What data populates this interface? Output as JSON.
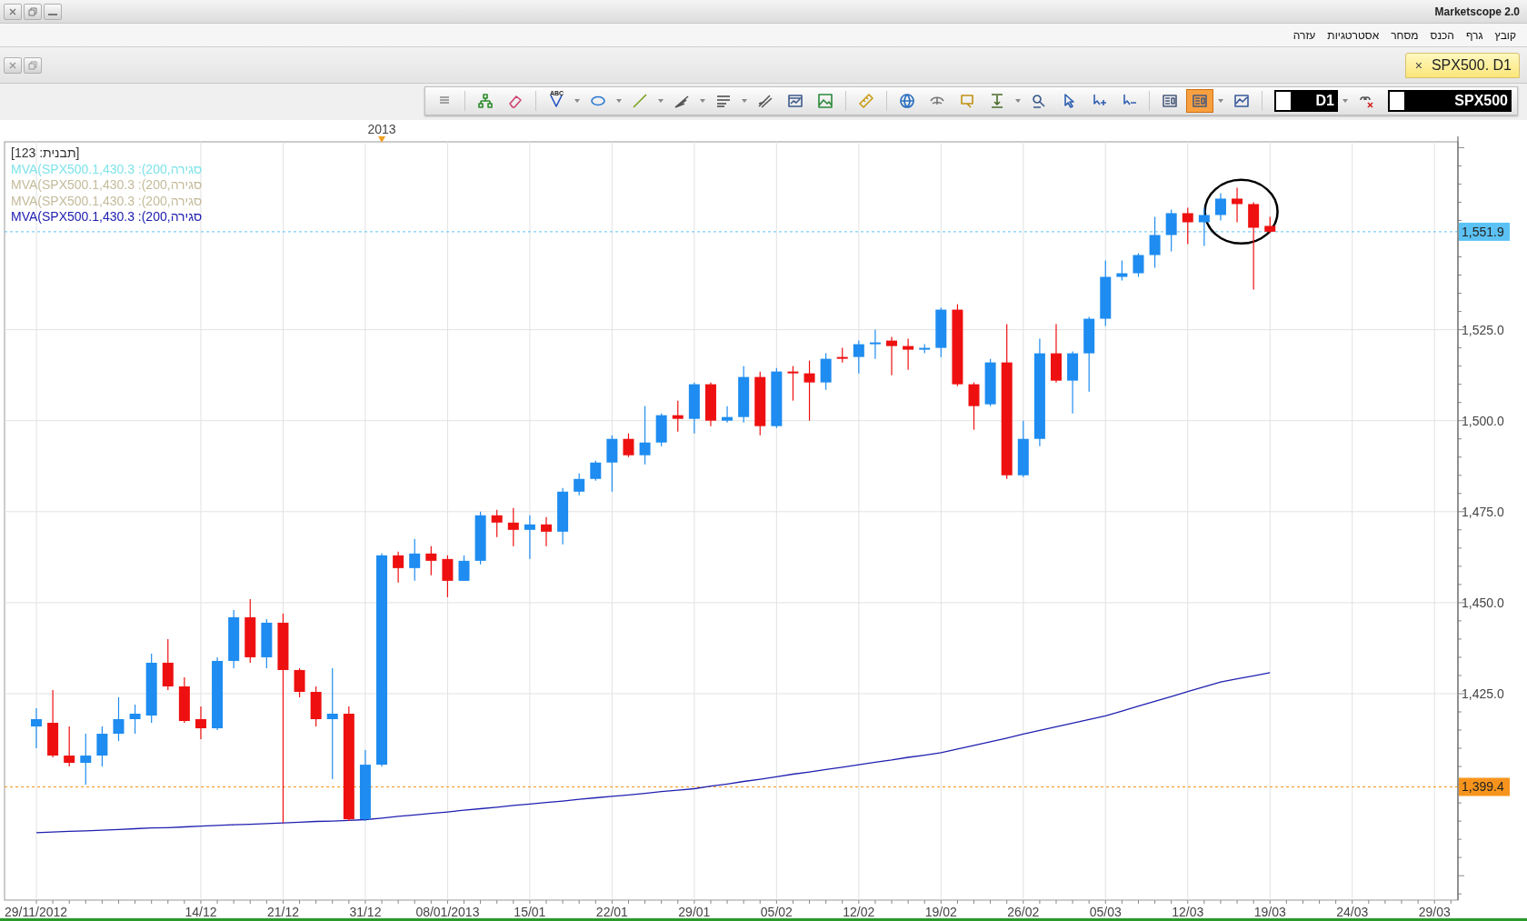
{
  "window": {
    "title": "Marketscope 2.0"
  },
  "menu": [
    "קובץ",
    "גרף",
    "הכנס",
    "מסחר",
    "אסטרטגיות",
    "עזרה"
  ],
  "document_tab": {
    "close": "×",
    "label": "SPX500. D1",
    "selected": true
  },
  "toolbar": {
    "tools": [
      {
        "kind": "grip",
        "selected": false,
        "caret": false
      },
      {
        "kind": "hierarchy",
        "selected": false,
        "caret": false
      },
      {
        "kind": "eraser",
        "selected": false,
        "caret": false
      },
      {
        "kind": "text",
        "label": "ABC",
        "selected": false,
        "caret": true
      },
      {
        "kind": "ellipse",
        "selected": false,
        "caret": true
      },
      {
        "kind": "pencil",
        "selected": false,
        "caret": true
      },
      {
        "kind": "fan",
        "selected": false,
        "caret": true
      },
      {
        "kind": "lines",
        "selected": false,
        "caret": true
      },
      {
        "kind": "fork",
        "selected": false,
        "caret": false
      },
      {
        "kind": "window",
        "selected": false,
        "caret": false
      },
      {
        "kind": "image",
        "selected": false,
        "caret": false
      },
      {
        "kind": "ruler",
        "selected": false,
        "caret": false
      },
      {
        "kind": "globe",
        "selected": false,
        "caret": false
      },
      {
        "kind": "eye",
        "selected": false,
        "caret": false
      },
      {
        "kind": "marker",
        "selected": false,
        "caret": false
      },
      {
        "kind": "level",
        "selected": false,
        "caret": true
      },
      {
        "kind": "zoom",
        "selected": false,
        "caret": false
      },
      {
        "kind": "cursor",
        "selected": false,
        "caret": false
      },
      {
        "kind": "cursor-plus",
        "selected": false,
        "caret": false
      },
      {
        "kind": "cursor-minus",
        "selected": false,
        "caret": false
      },
      {
        "kind": "panel",
        "selected": false,
        "caret": false
      },
      {
        "kind": "panel",
        "selected": true,
        "caret": true
      },
      {
        "kind": "chart",
        "selected": false,
        "caret": false
      }
    ],
    "timeframe": "D1",
    "instrument": "SPX500"
  },
  "chart": {
    "legend": [
      {
        "text": "[תבנית: 123]",
        "color": "#333333"
      },
      {
        "text": "MVA(SPX500.1,430.3 :(200,סגירה",
        "color": "#7fe3ea"
      },
      {
        "text": "MVA(SPX500.1,430.3 :(200,סגירה",
        "color": "#c4bb9a"
      },
      {
        "text": "MVA(SPX500.1,430.3 :(200,סגירה",
        "color": "#c4bb9a"
      }
    ],
    "year_label": "2013",
    "chart_data": {
      "type": "candlestick",
      "grid": true,
      "ylim": [
        1368.3,
        1576.6
      ],
      "categories": [
        "29/11/2012",
        null,
        null,
        null,
        null,
        null,
        null,
        null,
        null,
        null,
        "14/12",
        null,
        null,
        null,
        null,
        "21/12",
        null,
        null,
        null,
        null,
        "31/12",
        null,
        null,
        null,
        null,
        "08/01/2013",
        null,
        null,
        null,
        null,
        "15/01",
        null,
        null,
        null,
        null,
        "22/01",
        null,
        null,
        null,
        null,
        "29/01",
        null,
        null,
        null,
        null,
        "05/02",
        null,
        null,
        null,
        null,
        "12/02",
        null,
        null,
        null,
        null,
        "19/02",
        null,
        null,
        null,
        null,
        "26/02",
        null,
        null,
        null,
        null,
        "05/03",
        null,
        null,
        null,
        null,
        "12/03",
        null,
        null,
        null,
        null,
        "19/03",
        null,
        null,
        null,
        null,
        "24/03",
        null,
        null,
        null,
        null,
        "29/03",
        null
      ],
      "yticks": [
        {
          "value": 1425,
          "label": "1,425.0"
        },
        {
          "value": 1450,
          "label": "1,450.0"
        },
        {
          "value": 1475,
          "label": "1,475.0"
        },
        {
          "value": 1500,
          "label": "1,500.0"
        },
        {
          "value": 1525,
          "label": "1,525.0"
        }
      ],
      "series": [
        {
          "ohlc": [
            [
              1416,
              1421,
              1410,
              1418
            ],
            [
              1417,
              1426,
              1407.5,
              1408
            ],
            [
              1408,
              1416,
              1405,
              1406
            ],
            [
              1406,
              1414,
              1400,
              1408
            ],
            [
              1408,
              1416,
              1405,
              1414
            ],
            [
              1414,
              1424,
              1412,
              1418
            ],
            [
              1418,
              1422,
              1414,
              1419.5
            ],
            [
              1419,
              1436,
              1417,
              1433.5
            ],
            [
              1433.5,
              1440,
              1426,
              1427
            ],
            [
              1427,
              1429.5,
              1417,
              1417.5
            ],
            [
              1418,
              1421.5,
              1412.5,
              1415.5
            ],
            [
              1415.5,
              1435,
              1415,
              1434
            ],
            [
              1434,
              1448,
              1432,
              1446
            ],
            [
              1446,
              1451,
              1433.5,
              1435
            ],
            [
              1435,
              1445.5,
              1432,
              1444.5
            ],
            [
              1444.5,
              1447,
              1389.5,
              1431.5
            ],
            [
              1431.5,
              1432,
              1424,
              1425.5
            ],
            [
              1425.5,
              1427,
              1416,
              1418
            ],
            [
              1418,
              1432,
              1401.5,
              1419.5
            ],
            [
              1419.5,
              1421.5,
              1390,
              1390.5
            ],
            [
              1390.5,
              1409.5,
              1390,
              1405.5
            ],
            [
              1405.5,
              1463.5,
              1405,
              1463
            ],
            [
              1463,
              1464,
              1455.5,
              1459.5
            ],
            [
              1459.5,
              1467.5,
              1456,
              1463.5
            ],
            [
              1463.5,
              1465.5,
              1457.5,
              1461.5
            ],
            [
              1462,
              1463,
              1451.5,
              1456
            ],
            [
              1456,
              1463,
              1456,
              1461.5
            ],
            [
              1461.5,
              1475,
              1460.5,
              1474
            ],
            [
              1474,
              1475.5,
              1468,
              1472
            ],
            [
              1472,
              1476,
              1465.5,
              1470
            ],
            [
              1470,
              1474,
              1462,
              1471.5
            ],
            [
              1471.5,
              1473.5,
              1465.5,
              1469.5
            ],
            [
              1469.5,
              1481.5,
              1466,
              1480.5
            ],
            [
              1480.5,
              1485.5,
              1479.5,
              1484
            ],
            [
              1484,
              1489,
              1483.5,
              1488.5
            ],
            [
              1488.5,
              1496,
              1480.5,
              1495
            ],
            [
              1495,
              1496.5,
              1490,
              1490.5
            ],
            [
              1490.5,
              1504,
              1488,
              1494
            ],
            [
              1494,
              1502,
              1493,
              1501.5
            ],
            [
              1501.5,
              1505.5,
              1497,
              1500.5
            ],
            [
              1500.5,
              1510.5,
              1496.5,
              1510
            ],
            [
              1510,
              1510.5,
              1498.5,
              1500
            ],
            [
              1500,
              1504,
              1499.5,
              1501
            ],
            [
              1501,
              1515,
              1499.5,
              1512
            ],
            [
              1512,
              1513.5,
              1496,
              1498.5
            ],
            [
              1498.5,
              1514.5,
              1498,
              1513.5
            ],
            [
              1513.5,
              1515,
              1505.5,
              1513
            ],
            [
              1513,
              1516.5,
              1500,
              1510.5
            ],
            [
              1510.5,
              1518.5,
              1508.5,
              1517
            ],
            [
              1517.5,
              1520,
              1516,
              1517
            ],
            [
              1517.5,
              1522,
              1513,
              1521
            ],
            [
              1521,
              1525,
              1517,
              1521.5
            ],
            [
              1522,
              1523,
              1512.5,
              1520.5
            ],
            [
              1520.5,
              1522.5,
              1514,
              1519.5
            ],
            [
              1519.5,
              1521,
              1518.5,
              1520
            ],
            [
              1520,
              1531,
              1517.5,
              1530.5
            ],
            [
              1530.5,
              1532,
              1509.5,
              1510
            ],
            [
              1510,
              1510.5,
              1497.5,
              1504
            ],
            [
              1504.5,
              1517,
              1504,
              1516
            ],
            [
              1516,
              1526.5,
              1484,
              1485
            ],
            [
              1485,
              1500,
              1484.5,
              1495
            ],
            [
              1495,
              1522.5,
              1493,
              1518.5
            ],
            [
              1518.5,
              1526.5,
              1510.5,
              1511
            ],
            [
              1511,
              1519,
              1502,
              1518.5
            ],
            [
              1518.5,
              1528.5,
              1508,
              1528
            ],
            [
              1528,
              1544,
              1526,
              1539.5
            ],
            [
              1539.5,
              1544,
              1538.5,
              1540.5
            ],
            [
              1540.5,
              1546,
              1539.5,
              1545.5
            ],
            [
              1545.5,
              1556,
              1542,
              1551
            ],
            [
              1551,
              1558,
              1546.5,
              1557
            ],
            [
              1557,
              1558.5,
              1548.5,
              1554.5
            ],
            [
              1554.5,
              1558.5,
              1548,
              1556.5
            ],
            [
              1556.5,
              1562.5,
              1555,
              1561
            ],
            [
              1561,
              1564,
              1554.5,
              1559.5
            ],
            [
              1559.5,
              1560,
              1536,
              1553
            ],
            [
              1553.5,
              1556,
              1551.5,
              1551.9
            ],
            null,
            null,
            null,
            null,
            null,
            null,
            null,
            null,
            null,
            null,
            null
          ]
        },
        {
          "name": "MVA(SPX500.1,430.3 :(200,סגירה",
          "type": "line",
          "color": "#2020b0",
          "values": [
            1386.8,
            1387.0,
            1387.2,
            1387.3,
            1387.5,
            1387.7,
            1387.9,
            1388.1,
            1388.2,
            1388.4,
            1388.6,
            1388.8,
            1389.0,
            1389.1,
            1389.3,
            1389.5,
            1389.7,
            1389.9,
            1390.0,
            1390.2,
            1390.4,
            1390.8,
            1391.3,
            1391.7,
            1392.1,
            1392.5,
            1393.0,
            1393.4,
            1393.8,
            1394.3,
            1394.7,
            1395.1,
            1395.5,
            1396.0,
            1396.4,
            1396.8,
            1397.2,
            1397.6,
            1398.1,
            1398.5,
            1398.9,
            1399.6,
            1400.2,
            1400.9,
            1401.5,
            1402.2,
            1402.9,
            1403.5,
            1404.2,
            1404.8,
            1405.5,
            1406.2,
            1406.8,
            1407.5,
            1408.1,
            1408.8,
            1409.8,
            1410.8,
            1411.8,
            1412.8,
            1413.9,
            1414.9,
            1415.9,
            1416.9,
            1417.9,
            1418.9,
            1420.2,
            1421.6,
            1422.9,
            1424.2,
            1425.6,
            1426.9,
            1428.2,
            1429.1,
            1429.9,
            1430.8,
            null,
            null,
            null,
            null,
            null,
            null,
            null,
            null,
            null,
            null,
            null
          ]
        }
      ],
      "ref_lines": [
        {
          "axis": "y",
          "value": 1551.9,
          "label": "1,551.9",
          "color": "#5cc2f5"
        },
        {
          "axis": "y",
          "value": 1399.4,
          "label": "1,399.4",
          "color": "#f7941d"
        }
      ]
    }
  }
}
